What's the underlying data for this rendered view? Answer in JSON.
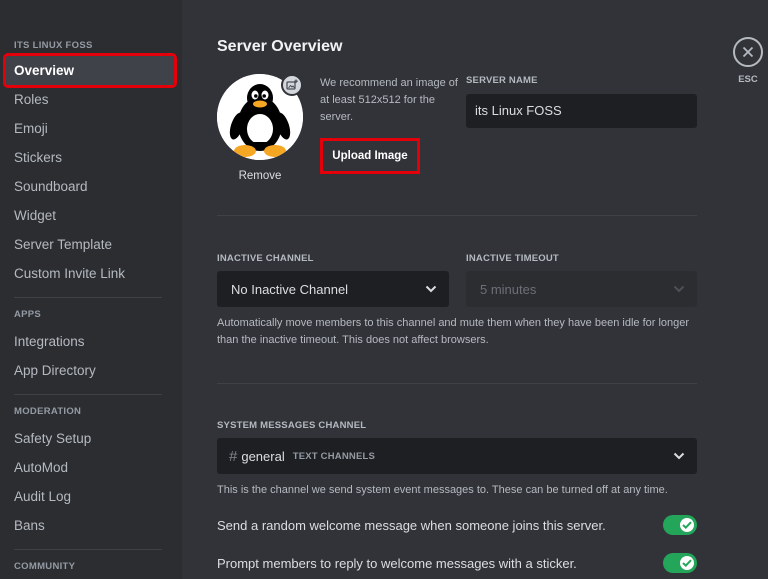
{
  "sidebar": {
    "server_header": "ITS LINUX FOSS",
    "items_main": [
      {
        "label": "Overview"
      },
      {
        "label": "Roles"
      },
      {
        "label": "Emoji"
      },
      {
        "label": "Stickers"
      },
      {
        "label": "Soundboard"
      },
      {
        "label": "Widget"
      },
      {
        "label": "Server Template"
      },
      {
        "label": "Custom Invite Link"
      }
    ],
    "apps_header": "APPS",
    "items_apps": [
      {
        "label": "Integrations"
      },
      {
        "label": "App Directory"
      }
    ],
    "moderation_header": "MODERATION",
    "items_moderation": [
      {
        "label": "Safety Setup"
      },
      {
        "label": "AutoMod"
      },
      {
        "label": "Audit Log"
      },
      {
        "label": "Bans"
      }
    ],
    "community_header": "COMMUNITY"
  },
  "main": {
    "title": "Server Overview",
    "avatar": {
      "icon": "tux-penguin-icon",
      "remove_label": "Remove"
    },
    "recommend_text": "We recommend an image of at least 512x512 for the server.",
    "upload_label": "Upload Image",
    "server_name": {
      "label": "SERVER NAME",
      "value": "its Linux FOSS"
    },
    "inactive_channel": {
      "label": "INACTIVE CHANNEL",
      "value": "No Inactive Channel"
    },
    "inactive_timeout": {
      "label": "INACTIVE TIMEOUT",
      "value": "5 minutes"
    },
    "inactive_help": "Automatically move members to this channel and mute them when they have been idle for longer than the inactive timeout. This does not affect browsers.",
    "system_channel": {
      "label": "SYSTEM MESSAGES CHANNEL",
      "channel": "general",
      "category": "TEXT CHANNELS",
      "help": "This is the channel we send system event messages to. These can be turned off at any time."
    },
    "toggles": [
      {
        "label": "Send a random welcome message when someone joins this server.",
        "on": true
      },
      {
        "label": "Prompt members to reply to welcome messages with a sticker.",
        "on": true
      }
    ]
  },
  "close": {
    "label": "ESC"
  },
  "colors": {
    "accent_green": "#23a55a",
    "highlight_red": "#e3000b",
    "background": "#313338",
    "sidebar": "#2b2d31"
  }
}
